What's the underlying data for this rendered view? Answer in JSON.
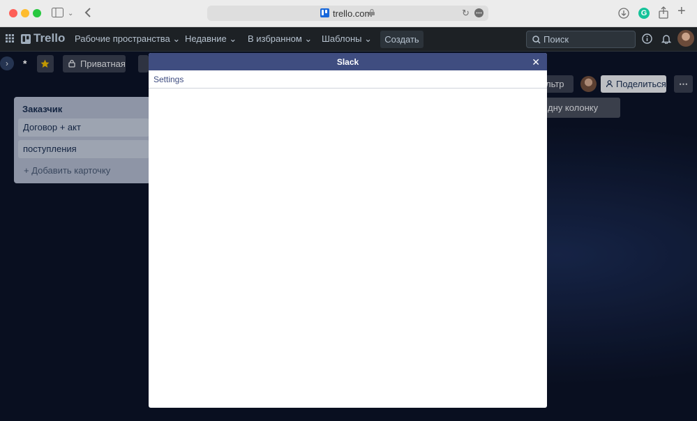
{
  "browser": {
    "url": "trello.com"
  },
  "header": {
    "brand": "Trello",
    "nav": [
      "Рабочие пространства",
      "Недавние",
      "В избранном",
      "Шаблоны"
    ],
    "create_label": "Создать",
    "search_placeholder": "Поиск"
  },
  "board": {
    "name": "*",
    "visibility_label": "Приватная",
    "filter_label_partial": "льтр",
    "share_label": "Поделиться",
    "add_list_partial": "дну колонку"
  },
  "list": {
    "title": "Заказчик",
    "cards": [
      "Договор + акт",
      "поступления"
    ],
    "add_card_label": "Добавить карточку"
  },
  "modal": {
    "title": "Slack",
    "tab_label": "Settings"
  }
}
